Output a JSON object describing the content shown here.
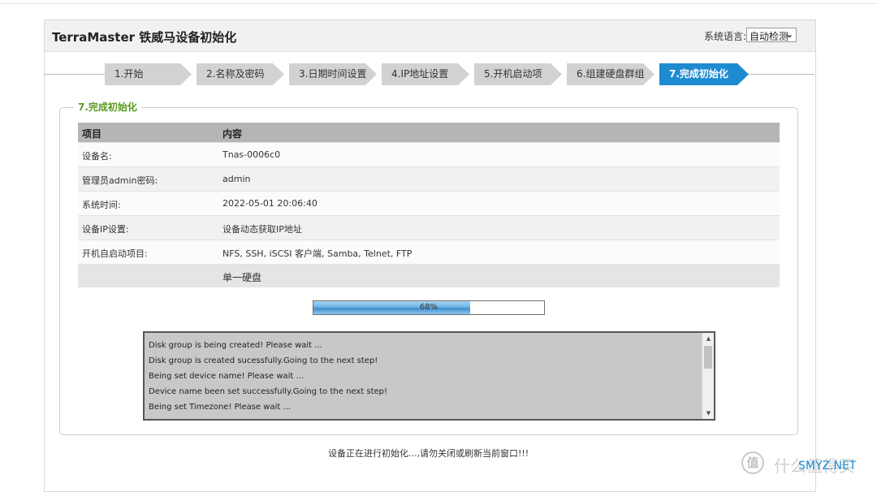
{
  "header": {
    "title": "TerraMaster 铁威马设备初始化",
    "language_label": "系统语言:",
    "language_value": "自动检测"
  },
  "steps": [
    {
      "label": "1.开始",
      "active": false
    },
    {
      "label": "2.名称及密码",
      "active": false
    },
    {
      "label": "3.日期时间设置",
      "active": false
    },
    {
      "label": "4.IP地址设置",
      "active": false
    },
    {
      "label": "5.开机启动项",
      "active": false
    },
    {
      "label": "6.组建硬盘群组",
      "active": false
    },
    {
      "label": "7.完成初始化",
      "active": true
    }
  ],
  "section": {
    "legend": "7.完成初始化"
  },
  "summary_table": {
    "headers": [
      "项目",
      "内容"
    ],
    "rows": [
      {
        "key": "设备名:",
        "value": "Tnas-0006c0"
      },
      {
        "key": "管理员admin密码:",
        "value": "admin"
      },
      {
        "key": "系统时间:",
        "value": "2022-05-01 20:06:40"
      },
      {
        "key": "设备IP设置:",
        "value": "设备动态获取IP地址"
      },
      {
        "key": "开机自启动项目:",
        "value": "NFS, SSH, iSCSI 客户端, Samba, Telnet, FTP"
      },
      {
        "key": "",
        "value": "单一硬盘"
      }
    ]
  },
  "progress": {
    "value": 0.68,
    "label": "68%"
  },
  "log": {
    "lines": [
      "Disk group is being created! Please wait ...",
      "Disk group is created sucessfully.Going to the next step!",
      "Being set device name! Please wait ...",
      "Device name been set successfully.Going to the next step!",
      "Being set Timezone! Please wait ..."
    ]
  },
  "footer": {
    "message": "设备正在进行初始化...,请勿关闭或刷新当前窗口!!!"
  },
  "watermark": {
    "icon_glyph": "值",
    "text": "什么值得买",
    "sub": "SMYZ.NET"
  }
}
